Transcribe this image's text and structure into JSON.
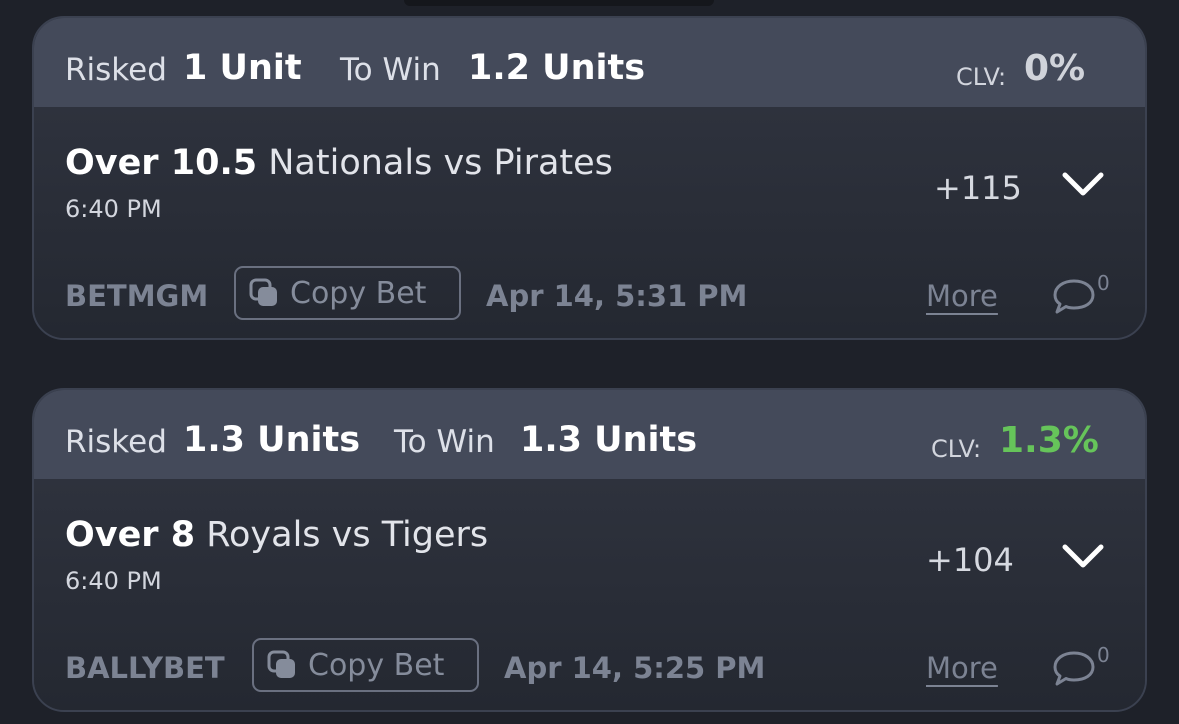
{
  "bets": [
    {
      "risked_label": "Risked",
      "risked_value": "1 Unit",
      "to_win_label": "To Win",
      "to_win_value": "1.2 Units",
      "clv_label": "CLV:",
      "clv_value": "0%",
      "clv_color": "#d0d3da",
      "pick_line": "Over 10.5",
      "pick_matchup": "Nationals vs Pirates",
      "game_time": "6:40 PM",
      "odds": "+115",
      "sportsbook": "BETMGM",
      "copy_label": "Copy Bet",
      "placed_at": "Apr 14, 5:31 PM",
      "more_label": "More",
      "comment_count": "0"
    },
    {
      "risked_label": "Risked",
      "risked_value": "1.3 Units",
      "to_win_label": "To Win",
      "to_win_value": "1.3 Units",
      "clv_label": "CLV:",
      "clv_value": "1.3%",
      "clv_color": "#66c45a",
      "pick_line": "Over 8",
      "pick_matchup": "Royals vs Tigers",
      "game_time": "6:40 PM",
      "odds": "+104",
      "sportsbook": "BALLYBET",
      "copy_label": "Copy Bet",
      "placed_at": "Apr 14, 5:25 PM",
      "more_label": "More",
      "comment_count": "0"
    }
  ],
  "icons": {
    "expand": "chevron-down-icon",
    "copy": "copy-icon",
    "comments": "comment-bubble-icon"
  }
}
